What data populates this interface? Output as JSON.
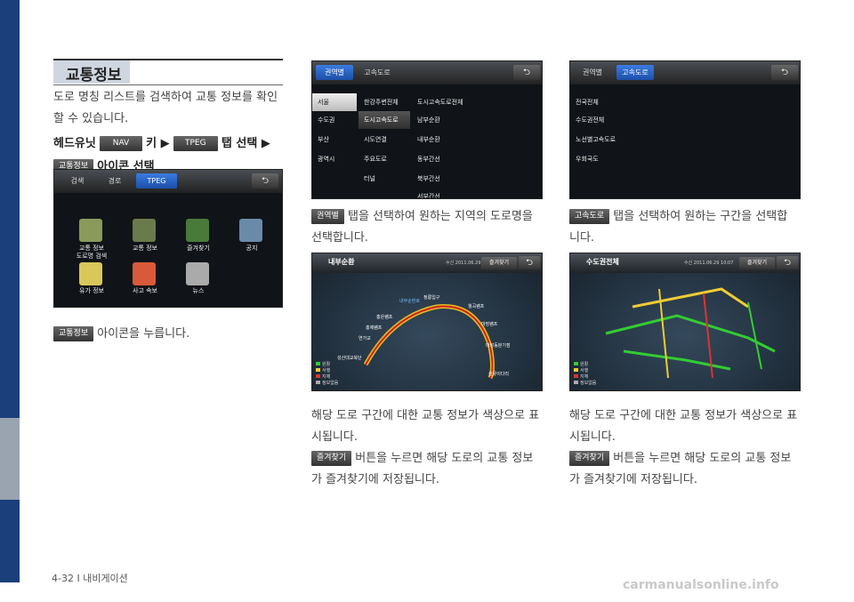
{
  "section_title": "교통정보",
  "intro": {
    "line1": "도로 명칭 리스트를 검색하여 교통 정보를 확인",
    "line2": "할 수 있습니다.",
    "step_prefix": "헤드유닛",
    "nav_chip": "NAV",
    "step_key": "키 ▶",
    "tpeg_chip": "TPEG",
    "step_tab": "탭 선택 ▶",
    "traffic_chip": "교통정보",
    "step_icon": "아이콘 선택"
  },
  "tpeg_screen": {
    "tabs": [
      "검색",
      "경로",
      "TPEG"
    ],
    "back": "⮌",
    "items": [
      {
        "label": "교통 정보\n도로명 검색",
        "icon": "traffic-road-search-icon",
        "color": "#8a9a5a"
      },
      {
        "label": "교통 정보",
        "icon": "traffic-info-icon",
        "color": "#6a7a4a"
      },
      {
        "label": "즐겨찾기",
        "icon": "favorites-icon",
        "color": "#4a7a3a"
      },
      {
        "label": "공지",
        "icon": "notice-icon",
        "color": "#6a8aaa"
      },
      {
        "label": "유가 정보",
        "icon": "fuel-price-icon",
        "color": "#d8c85a"
      },
      {
        "label": "사고 속보",
        "icon": "accident-news-icon",
        "color": "#d85a3a"
      },
      {
        "label": "뉴스",
        "icon": "news-icon",
        "color": "#aaaaaa"
      }
    ]
  },
  "press_note": {
    "chip": "교통정보",
    "text": "아이콘을 누릅니다."
  },
  "region_screen": {
    "tabs": [
      "권역별",
      "고속도로"
    ],
    "left": [
      "서울",
      "수도권",
      "부산",
      "광역시"
    ],
    "mid": [
      "한강주변전체",
      "도시고속도로",
      "시도연결",
      "주요도로",
      "터널"
    ],
    "right": [
      "도시고속도로전체",
      "남부순환",
      "내부순환",
      "동부간선",
      "북부간선",
      "서부간선"
    ]
  },
  "region_note": {
    "chip": "권역별",
    "line1": "탭을 선택하여 원하는 지역의 도로명을",
    "line2": "선택합니다."
  },
  "highway_screen": {
    "tabs": [
      "권역별",
      "고속도로"
    ],
    "items": [
      "전국전체",
      "수도권전체",
      "노선별고속도로",
      "우회국도"
    ]
  },
  "highway_note": {
    "chip": "고속도로",
    "line1": "탭을 선택하여 원하는 구간을 선택합",
    "line2": "니다."
  },
  "map1": {
    "title": "내부순환",
    "time": "수신 2011.06.29 10:07",
    "fav": "즐겨찾기",
    "labels": [
      "정릉입구",
      "월곡램프",
      "마장램프",
      "마장동분기점",
      "살곶이다리",
      "홍은램프",
      "홍제램프",
      "연가교",
      "성산대교북단",
      "내부순환로"
    ],
    "legend": [
      "원활",
      "서행",
      "지체",
      "정보없음"
    ]
  },
  "map2": {
    "title": "수도권전체",
    "time": "수신 2011.06.29 10:07",
    "fav": "즐겨찾기",
    "legend": [
      "원활",
      "서행",
      "지체",
      "정보없음"
    ]
  },
  "note1": {
    "line1": "해당 도로 구간에 대한 교통 정보가 색상으로 표",
    "line2": "시됩니다.",
    "chip": "즐겨찾기",
    "line3": "버튼을 누르면 해당 도로의 교통 정보",
    "line4": "가 즐겨찾기에 저장됩니다."
  },
  "note2": {
    "line1": "해당 도로 구간에 대한 교통 정보가 색상으로 표",
    "line2": "시됩니다.",
    "chip": "즐겨찾기",
    "line3": "버튼을 누르면 해당 도로의 교통 정보",
    "line4": "가 즐겨찾기에 저장됩니다."
  },
  "footer": "4-32 I 내비게이션",
  "watermark": "carmanualsonline.info"
}
